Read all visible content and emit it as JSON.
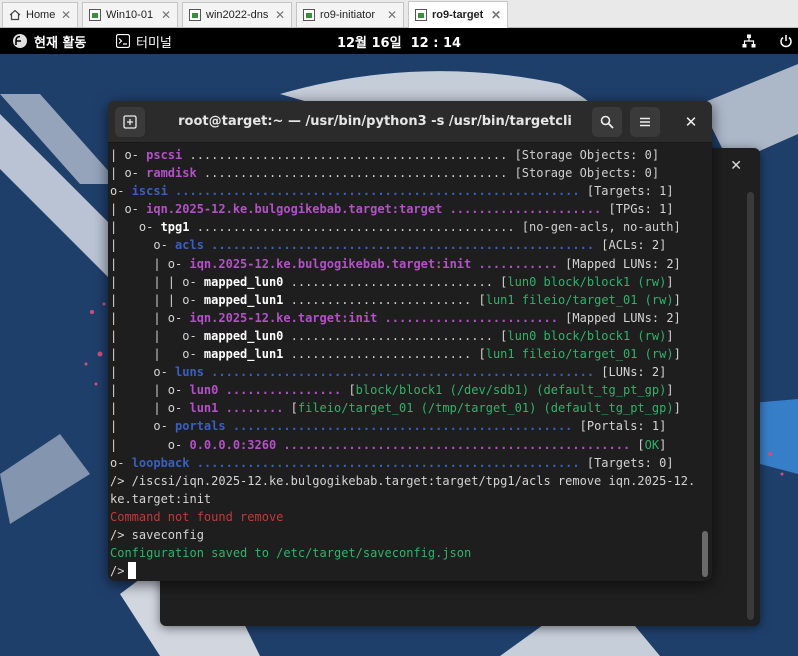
{
  "tabs": [
    {
      "label": "Home",
      "icon": "home-icon"
    },
    {
      "label": "Win10-01",
      "icon": "vm-icon"
    },
    {
      "label": "win2022-dns",
      "icon": "vm-icon"
    },
    {
      "label": "ro9-initiator",
      "icon": "vm-icon"
    },
    {
      "label": "ro9-target",
      "icon": "vm-icon",
      "active": true
    }
  ],
  "topbar": {
    "activities": "현재 활동",
    "app": "터미널",
    "clock": "12월 16일  12 : 14"
  },
  "terminal": {
    "title": "root@target:~ — /usr/bin/python3 -s /usr/bin/targetcli",
    "lines": [
      [
        [
          "c-br",
          "| o- "
        ],
        [
          "c-pur",
          "pscsi"
        ],
        [
          "c-dim",
          " ............................................ [Storage Objects: 0]"
        ]
      ],
      [
        [
          "c-br",
          "| o- "
        ],
        [
          "c-pur",
          "ramdisk"
        ],
        [
          "c-dim",
          " .......................................... [Storage Objects: 0]"
        ]
      ],
      [
        [
          "c-br",
          "o- "
        ],
        [
          "c-blu",
          "iscsi"
        ],
        [
          "c-blu",
          " ........................................................ "
        ],
        [
          "c-br",
          "[Targets: 1]"
        ]
      ],
      [
        [
          "c-br",
          "| o- "
        ],
        [
          "c-pur",
          "iqn.2025-12.ke.bulgogikebab.target:target"
        ],
        [
          "c-pur",
          " ..................... "
        ],
        [
          "c-br",
          "[TPGs: 1]"
        ]
      ],
      [
        [
          "c-br",
          "|   o- "
        ],
        [
          "c-wht",
          "tpg1"
        ],
        [
          "c-dim",
          " ............................................ [no-gen-acls, no-auth]"
        ]
      ],
      [
        [
          "c-br",
          "|     o- "
        ],
        [
          "c-blu",
          "acls"
        ],
        [
          "c-blu",
          " ..................................................... "
        ],
        [
          "c-br",
          "[ACLs: 2]"
        ]
      ],
      [
        [
          "c-br",
          "|     | o- "
        ],
        [
          "c-pur",
          "iqn.2025-12.ke.bulgogikebab.target:init"
        ],
        [
          "c-pur",
          " ........... "
        ],
        [
          "c-br",
          "[Mapped LUNs: 2]"
        ]
      ],
      [
        [
          "c-br",
          "|     | | o- "
        ],
        [
          "c-wht",
          "mapped_lun0"
        ],
        [
          "c-dim",
          " ............................ "
        ],
        [
          "c-br",
          "["
        ],
        [
          "c-grn",
          "lun0 block/block1 (rw)"
        ],
        [
          "c-br",
          "]"
        ]
      ],
      [
        [
          "c-br",
          "|     | | o- "
        ],
        [
          "c-wht",
          "mapped_lun1"
        ],
        [
          "c-dim",
          " ......................... "
        ],
        [
          "c-br",
          "["
        ],
        [
          "c-grn",
          "lun1 fileio/target_01 (rw)"
        ],
        [
          "c-br",
          "]"
        ]
      ],
      [
        [
          "c-br",
          "|     | o- "
        ],
        [
          "c-pur",
          "iqn.2025-12.ke.target:init"
        ],
        [
          "c-pur",
          " ........................ "
        ],
        [
          "c-br",
          "[Mapped LUNs: 2]"
        ]
      ],
      [
        [
          "c-br",
          "|     |   o- "
        ],
        [
          "c-wht",
          "mapped_lun0"
        ],
        [
          "c-dim",
          " ............................ "
        ],
        [
          "c-br",
          "["
        ],
        [
          "c-grn",
          "lun0 block/block1 (rw)"
        ],
        [
          "c-br",
          "]"
        ]
      ],
      [
        [
          "c-br",
          "|     |   o- "
        ],
        [
          "c-wht",
          "mapped_lun1"
        ],
        [
          "c-dim",
          " ......................... "
        ],
        [
          "c-br",
          "["
        ],
        [
          "c-grn",
          "lun1 fileio/target_01 (rw)"
        ],
        [
          "c-br",
          "]"
        ]
      ],
      [
        [
          "c-br",
          "|     o- "
        ],
        [
          "c-blu",
          "luns"
        ],
        [
          "c-blu",
          " ..................................................... "
        ],
        [
          "c-br",
          "[LUNs: 2]"
        ]
      ],
      [
        [
          "c-br",
          "|     | o- "
        ],
        [
          "c-pur",
          "lun0"
        ],
        [
          "c-pur",
          " ................ "
        ],
        [
          "c-br",
          "["
        ],
        [
          "c-grn",
          "block/block1 (/dev/sdb1) (default_tg_pt_gp)"
        ],
        [
          "c-br",
          "]"
        ]
      ],
      [
        [
          "c-br",
          "|     | o- "
        ],
        [
          "c-pur",
          "lun1"
        ],
        [
          "c-pur",
          " ........ "
        ],
        [
          "c-br",
          "["
        ],
        [
          "c-grn",
          "fileio/target_01 (/tmp/target_01) (default_tg_pt_gp)"
        ],
        [
          "c-br",
          "]"
        ]
      ],
      [
        [
          "c-br",
          "|     o- "
        ],
        [
          "c-blu",
          "portals"
        ],
        [
          "c-blu",
          " ............................................... "
        ],
        [
          "c-br",
          "[Portals: 1]"
        ]
      ],
      [
        [
          "c-br",
          "|       o- "
        ],
        [
          "c-pur",
          "0.0.0.0:3260"
        ],
        [
          "c-pur",
          " ................................................ "
        ],
        [
          "c-br",
          "["
        ],
        [
          "c-grn",
          "OK"
        ],
        [
          "c-br",
          "]"
        ]
      ],
      [
        [
          "c-br",
          "o- "
        ],
        [
          "c-blu",
          "loopback"
        ],
        [
          "c-blu",
          " ..................................................... "
        ],
        [
          "c-br",
          "[Targets: 0]"
        ]
      ],
      [
        [
          "c-br",
          "/> /iscsi/iqn.2025-12.ke.bulgogikebab.target:target/tpg1/acls remove iqn.2025-12."
        ]
      ],
      [
        [
          "c-br",
          "ke.target:init"
        ]
      ],
      [
        [
          "c-red",
          "Command not found remove"
        ]
      ],
      [
        [
          "c-br",
          "/> saveconfig"
        ]
      ],
      [
        [
          "c-grn",
          "Configuration saved to /etc/target/saveconfig.json"
        ]
      ],
      [
        [
          "c-br",
          "/>"
        ]
      ]
    ]
  }
}
